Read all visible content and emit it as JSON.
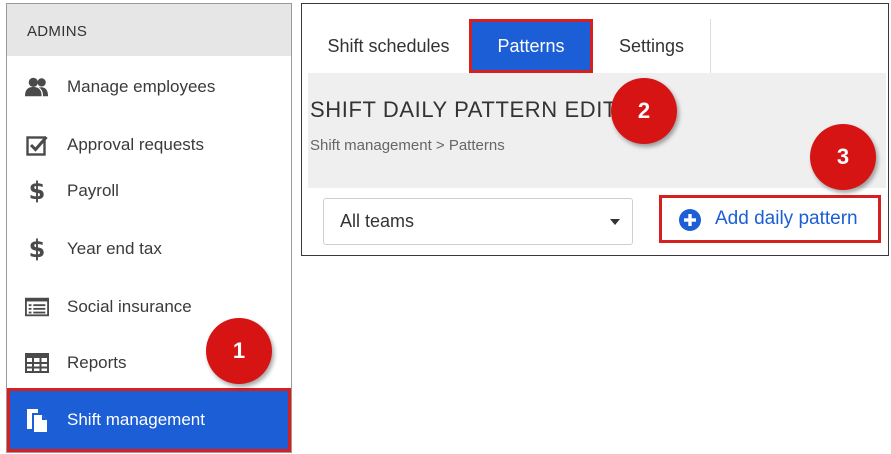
{
  "sidebar": {
    "header": "ADMINS",
    "items": [
      {
        "label": "Manage employees",
        "icon": "users-icon"
      },
      {
        "label": "Approval requests",
        "icon": "checkbox-icon"
      },
      {
        "label": "Payroll",
        "icon": "dollar-icon"
      },
      {
        "label": "Year end tax",
        "icon": "dollar-icon"
      },
      {
        "label": "Social insurance",
        "icon": "list-card-icon"
      },
      {
        "label": "Reports",
        "icon": "table-icon"
      },
      {
        "label": "Shift management",
        "icon": "documents-icon",
        "active": true
      }
    ],
    "dollar_glyph": "$"
  },
  "main": {
    "tabs": [
      {
        "label": "Shift schedules"
      },
      {
        "label": "Patterns",
        "active": true
      },
      {
        "label": "Settings"
      }
    ],
    "title": "SHIFT DAILY PATTERN EDIT",
    "breadcrumb": "Shift management > Patterns",
    "team_filter": {
      "value": "All teams"
    },
    "add_button": {
      "label": "Add daily pattern",
      "icon": "plus-circle-icon"
    }
  },
  "callouts": [
    "1",
    "2",
    "3"
  ],
  "colors": {
    "accent": "#1b5ed6",
    "highlight": "#d61f1f",
    "callout": "#d61414"
  }
}
